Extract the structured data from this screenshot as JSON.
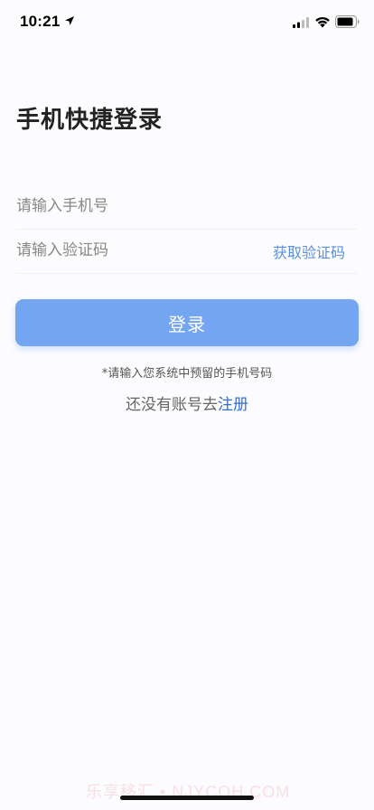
{
  "status_bar": {
    "time": "10:21",
    "icons": [
      "location-arrow-icon",
      "signal-icon",
      "wifi-icon",
      "battery-icon"
    ]
  },
  "login": {
    "title": "手机快捷登录",
    "phone_placeholder": "请输入手机号",
    "code_placeholder": "请输入验证码",
    "get_code_label": "获取验证码",
    "login_button_label": "登录",
    "hint": "*请输入您系统中预留的手机号码",
    "register_prefix": "还没有账号去",
    "register_link": "注册"
  },
  "watermark": "乐享移汇 • NJYCQH.COM",
  "colors": {
    "primary_button": "#73a5f0",
    "link": "#2f6fd8",
    "get_code": "#5b8fdc",
    "background": "#fcfcfe"
  }
}
